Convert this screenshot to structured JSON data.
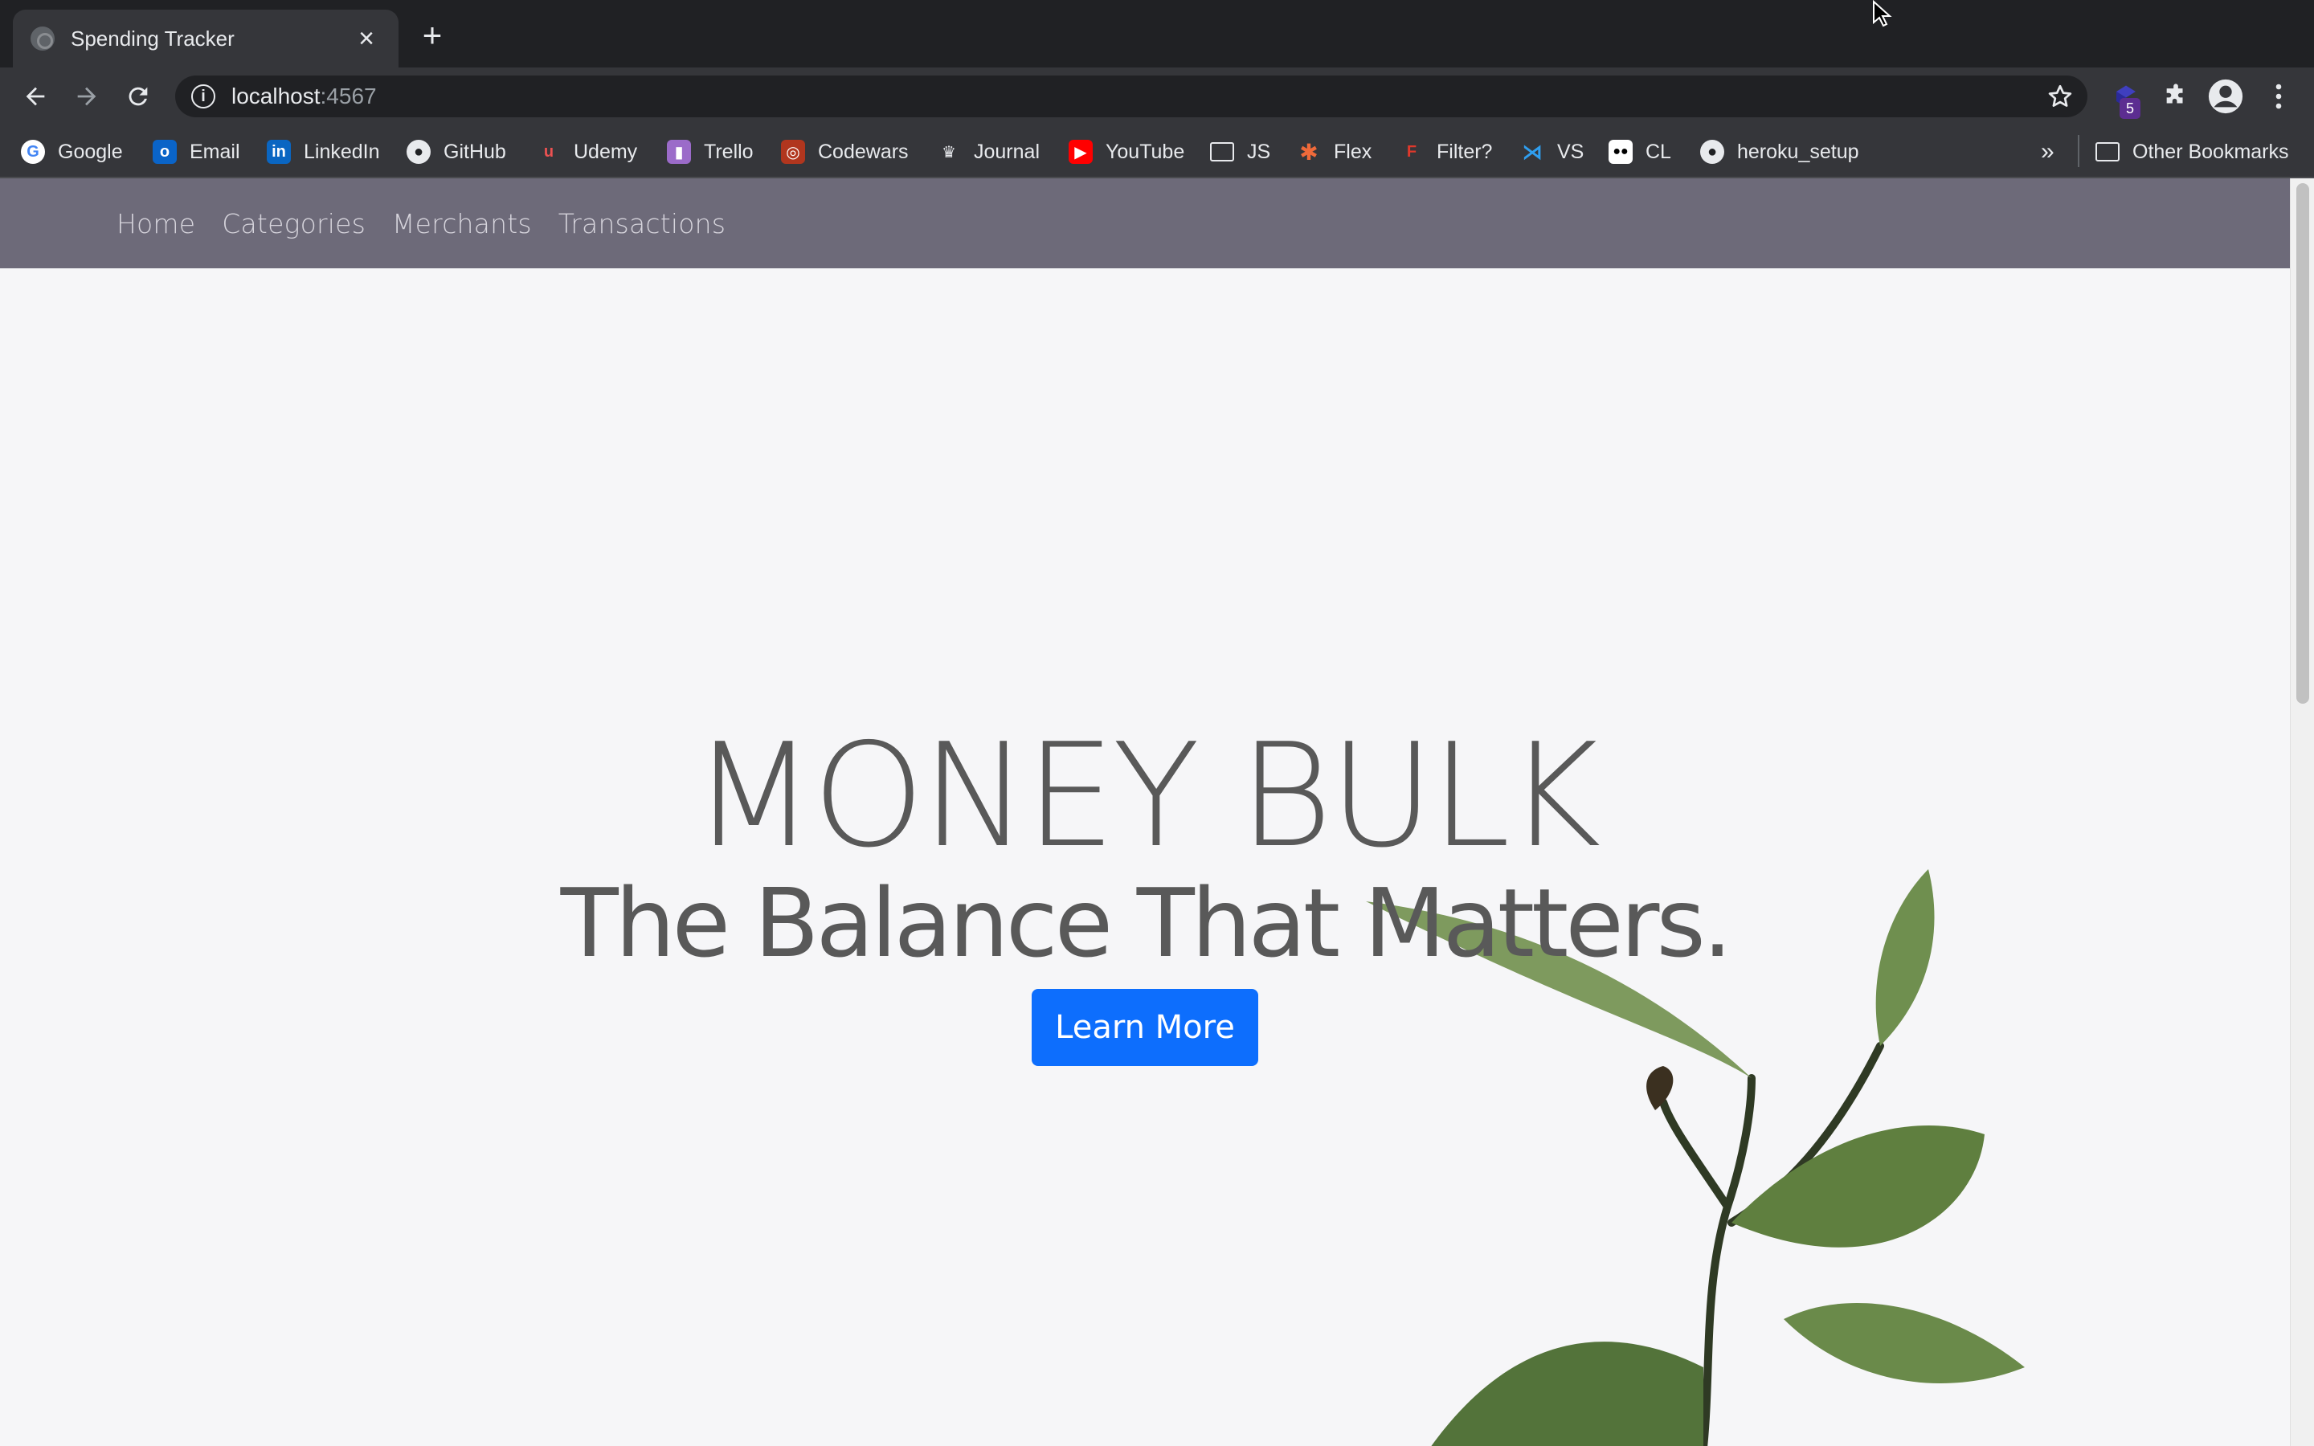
{
  "browser": {
    "tab": {
      "title": "Spending Tracker"
    },
    "address": {
      "host": "localhost",
      "port": ":4567"
    },
    "extension_badge": "5",
    "bookmarks": [
      {
        "label": "Google",
        "icon": "google-icon"
      },
      {
        "label": "Email",
        "icon": "outlook-icon"
      },
      {
        "label": "LinkedIn",
        "icon": "linkedin-icon"
      },
      {
        "label": "GitHub",
        "icon": "github-icon"
      },
      {
        "label": "Udemy",
        "icon": "udemy-icon"
      },
      {
        "label": "Trello",
        "icon": "trello-icon"
      },
      {
        "label": "Codewars",
        "icon": "codewars-icon"
      },
      {
        "label": "Journal",
        "icon": "journal-icon"
      },
      {
        "label": "YouTube",
        "icon": "youtube-icon"
      },
      {
        "label": "JS",
        "icon": "folder-icon"
      },
      {
        "label": "Flex",
        "icon": "flex-icon"
      },
      {
        "label": "Filter?",
        "icon": "filter-icon"
      },
      {
        "label": "VS",
        "icon": "vscode-icon"
      },
      {
        "label": "CL",
        "icon": "medium-icon"
      },
      {
        "label": "heroku_setup",
        "icon": "github-icon"
      }
    ],
    "more_bookmarks": "»",
    "other_bookmarks": "Other Bookmarks"
  },
  "site": {
    "nav": [
      "Home",
      "Categories",
      "Merchants",
      "Transactions"
    ],
    "hero": {
      "title": "MONEY BULK",
      "subtitle": "The Balance That Matters.",
      "cta": "Learn More"
    }
  },
  "colors": {
    "nav_bg": "#6d6a79",
    "page_bg": "#f6f6f8",
    "cta_bg": "#0d6efd",
    "hero_text": "#595959"
  }
}
